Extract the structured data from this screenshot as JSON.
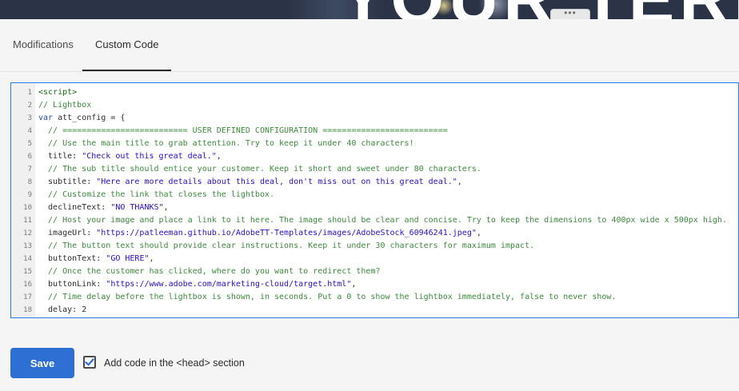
{
  "banner": {
    "text": "YOUR TERMS",
    "handle": "•••"
  },
  "tabs": [
    {
      "label": "Modifications",
      "active": false
    },
    {
      "label": "Custom Code",
      "active": true
    }
  ],
  "editor": {
    "lines": [
      [
        [
          "tag",
          "<script>"
        ]
      ],
      [
        [
          "com",
          "// Lightbox"
        ]
      ],
      [
        [
          "kw",
          "var"
        ],
        [
          "plain",
          " att_config = {"
        ]
      ],
      [
        [
          "com",
          "  // ========================== USER DEFINED CONFIGURATION =========================="
        ]
      ],
      [
        [
          "com",
          "  // Use the main title to grab attention. Try to keep it under 40 characters!"
        ]
      ],
      [
        [
          "prop",
          "  title: "
        ],
        [
          "str",
          "\"Check out this great deal.\""
        ],
        [
          "plain",
          ","
        ]
      ],
      [
        [
          "com",
          "  // The sub title should entice your customer. Keep it short and sweet under 80 characters."
        ]
      ],
      [
        [
          "prop",
          "  subtitle: "
        ],
        [
          "str",
          "\"Here are more details about this deal, don't miss out on this great deal.\""
        ],
        [
          "plain",
          ","
        ]
      ],
      [
        [
          "com",
          "  // Customize the link that closes the lightbox."
        ]
      ],
      [
        [
          "prop",
          "  declineText: "
        ],
        [
          "str",
          "\"NO THANKS\""
        ],
        [
          "plain",
          ","
        ]
      ],
      [
        [
          "com",
          "  // Host your image and place a link to it here. The image should be clear and concise. Try to keep the dimensions to 400px wide x 500px high."
        ]
      ],
      [
        [
          "prop",
          "  imageUrl: "
        ],
        [
          "str",
          "\"https://patleeman.github.io/AdobeTT-Templates/images/AdobeStock_60946241.jpeg\""
        ],
        [
          "plain",
          ","
        ]
      ],
      [
        [
          "com",
          "  // The button text should provide clear instructions. Keep it under 30 characters for maximum impact."
        ]
      ],
      [
        [
          "prop",
          "  buttonText: "
        ],
        [
          "str",
          "\"GO HERE\""
        ],
        [
          "plain",
          ","
        ]
      ],
      [
        [
          "com",
          "  // Once the customer has clicked, where do you want to redirect them?"
        ]
      ],
      [
        [
          "prop",
          "  buttonLink: "
        ],
        [
          "str",
          "\"https://www.adobe.com/marketing-cloud/target.html\""
        ],
        [
          "plain",
          ","
        ]
      ],
      [
        [
          "com",
          "  // Time delay before the lightbox is shown, in seconds. Put a 0 to show the lightbox immediately, false to never show."
        ]
      ],
      [
        [
          "prop",
          "  delay: "
        ],
        [
          "plain",
          "2"
        ]
      ]
    ]
  },
  "footer": {
    "save_label": "Save",
    "checkbox_label": "Add code in the <head> section",
    "checkbox_checked": true
  },
  "colors": {
    "accent": "#2d6fd3",
    "editor_border": "#2680eb"
  }
}
